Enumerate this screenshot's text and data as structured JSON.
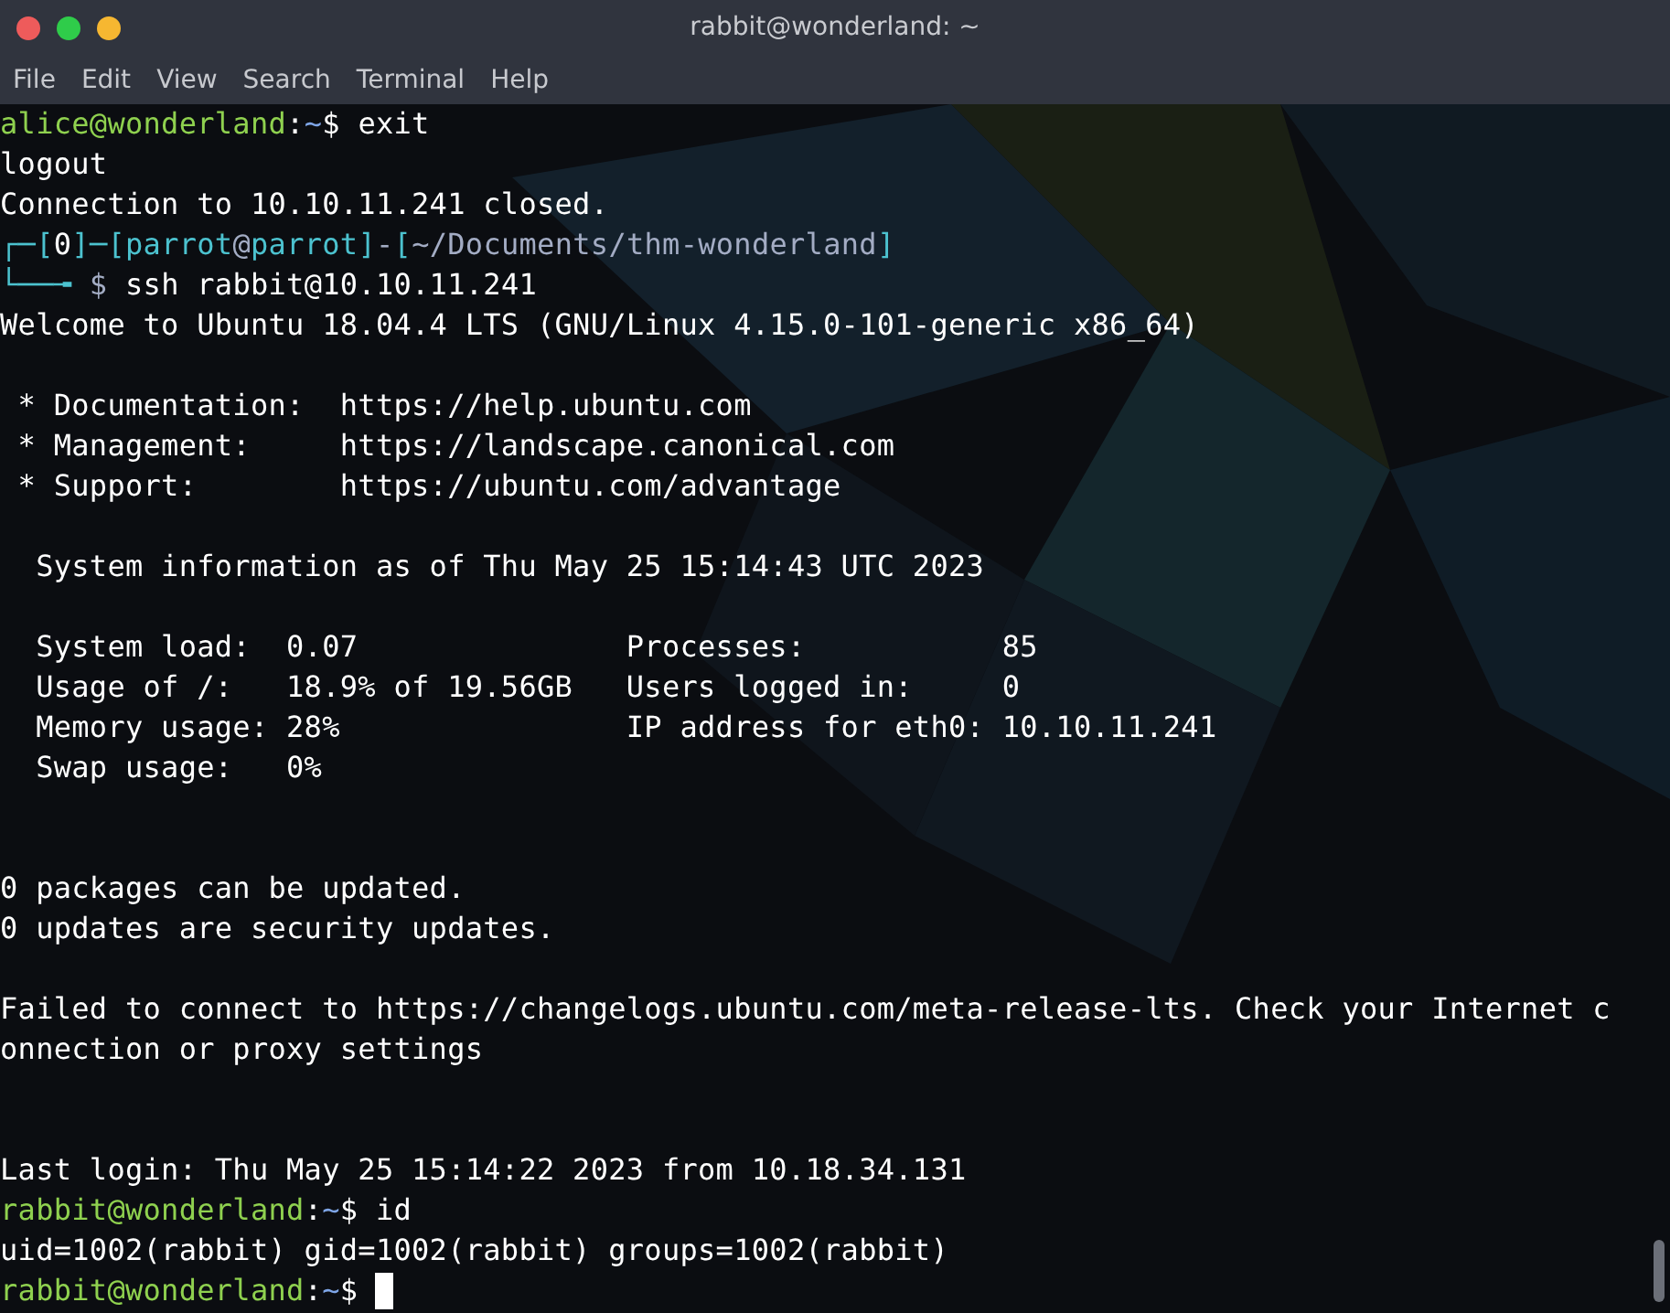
{
  "window": {
    "title": "rabbit@wonderland: ~",
    "buttons": [
      {
        "color": "#ee5b5b"
      },
      {
        "color": "#2fcc4a"
      },
      {
        "color": "#f6b731"
      }
    ]
  },
  "menu": [
    "File",
    "Edit",
    "View",
    "Search",
    "Terminal",
    "Help"
  ],
  "terminal": {
    "lines": [
      {
        "segments": [
          {
            "kind": "user",
            "text": "alice@wonderland"
          },
          {
            "kind": "plain",
            "text": ":"
          },
          {
            "kind": "path",
            "text": "~"
          },
          {
            "kind": "plain",
            "text": "$ exit"
          }
        ]
      },
      {
        "segments": [
          {
            "kind": "plain",
            "text": "logout"
          }
        ]
      },
      {
        "segments": [
          {
            "kind": "plain",
            "text": "Connection to 10.10.11.241 closed."
          }
        ]
      },
      {
        "segments": [
          {
            "kind": "frame",
            "text": "┌─["
          },
          {
            "kind": "plain",
            "text": "0"
          },
          {
            "kind": "frame",
            "text": "]─[parrot"
          },
          {
            "kind": "muted",
            "text": "@"
          },
          {
            "kind": "frame",
            "text": "parrot]"
          },
          {
            "kind": "muted",
            "text": "-"
          },
          {
            "kind": "frame",
            "text": "["
          },
          {
            "kind": "muted",
            "text": "~/Documents/thm-wonderland"
          },
          {
            "kind": "frame",
            "text": "]"
          }
        ]
      },
      {
        "segments": [
          {
            "kind": "frame",
            "text": "└──╼ "
          },
          {
            "kind": "muted",
            "text": "$ "
          },
          {
            "kind": "plain",
            "text": "ssh rabbit@10.10.11.241"
          }
        ]
      },
      {
        "segments": [
          {
            "kind": "plain",
            "text": "Welcome to Ubuntu 18.04.4 LTS (GNU/Linux 4.15.0-101-generic x86_64)"
          }
        ]
      },
      {
        "kind": "blank"
      },
      {
        "segments": [
          {
            "kind": "plain",
            "text": " * Documentation:  https://help.ubuntu.com"
          }
        ]
      },
      {
        "segments": [
          {
            "kind": "plain",
            "text": " * Management:     https://landscape.canonical.com"
          }
        ]
      },
      {
        "segments": [
          {
            "kind": "plain",
            "text": " * Support:        https://ubuntu.com/advantage"
          }
        ]
      },
      {
        "kind": "blank"
      },
      {
        "segments": [
          {
            "kind": "plain",
            "text": "  System information as of Thu May 25 15:14:43 UTC 2023"
          }
        ]
      },
      {
        "kind": "blank"
      },
      {
        "segments": [
          {
            "kind": "plain",
            "text": "  System load:  0.07               Processes:           85"
          }
        ]
      },
      {
        "segments": [
          {
            "kind": "plain",
            "text": "  Usage of /:   18.9% of 19.56GB   Users logged in:     0"
          }
        ]
      },
      {
        "segments": [
          {
            "kind": "plain",
            "text": "  Memory usage: 28%                IP address for eth0: 10.10.11.241"
          }
        ]
      },
      {
        "segments": [
          {
            "kind": "plain",
            "text": "  Swap usage:   0%"
          }
        ]
      },
      {
        "kind": "blank"
      },
      {
        "kind": "blank"
      },
      {
        "segments": [
          {
            "kind": "plain",
            "text": "0 packages can be updated."
          }
        ]
      },
      {
        "segments": [
          {
            "kind": "plain",
            "text": "0 updates are security updates."
          }
        ]
      },
      {
        "kind": "blank"
      },
      {
        "segments": [
          {
            "kind": "plain",
            "text": "Failed to connect to https://changelogs.ubuntu.com/meta-release-lts. Check your Internet c"
          }
        ]
      },
      {
        "segments": [
          {
            "kind": "plain",
            "text": "onnection or proxy settings"
          }
        ]
      },
      {
        "kind": "blank"
      },
      {
        "kind": "blank"
      },
      {
        "segments": [
          {
            "kind": "plain",
            "text": "Last login: Thu May 25 15:14:22 2023 from 10.18.34.131"
          }
        ]
      },
      {
        "segments": [
          {
            "kind": "user",
            "text": "rabbit@wonderland"
          },
          {
            "kind": "plain",
            "text": ":"
          },
          {
            "kind": "path",
            "text": "~"
          },
          {
            "kind": "plain",
            "text": "$ id"
          }
        ]
      },
      {
        "segments": [
          {
            "kind": "plain",
            "text": "uid=1002(rabbit) gid=1002(rabbit) groups=1002(rabbit)"
          }
        ]
      },
      {
        "segments": [
          {
            "kind": "user",
            "text": "rabbit@wonderland"
          },
          {
            "kind": "plain",
            "text": ":"
          },
          {
            "kind": "path",
            "text": "~"
          },
          {
            "kind": "plain",
            "text": "$ "
          }
        ],
        "cursor": true
      }
    ]
  }
}
